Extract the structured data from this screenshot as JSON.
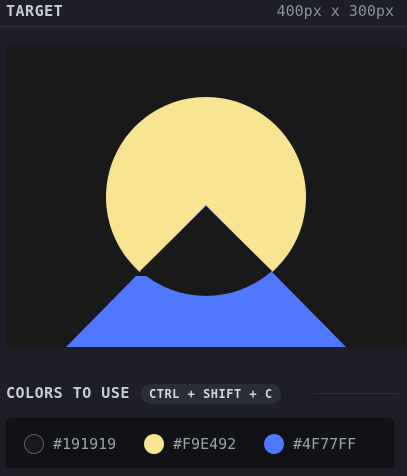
{
  "header": {
    "title": "TARGET",
    "dimensions": "400px x 300px"
  },
  "target": {
    "background": "#191919",
    "shapes": [
      {
        "kind": "circle",
        "color": "#F9E492"
      },
      {
        "kind": "triangle",
        "color": "#4F77FF"
      },
      {
        "kind": "triangle",
        "color": "#191919"
      }
    ]
  },
  "colors_section": {
    "title": "COLORS TO USE",
    "shortcut": "CTRL + SHIFT + C"
  },
  "palette": [
    {
      "hex": "#191919",
      "label": "#191919"
    },
    {
      "hex": "#F9E492",
      "label": "#F9E492"
    },
    {
      "hex": "#4F77FF",
      "label": "#4F77FF"
    }
  ]
}
